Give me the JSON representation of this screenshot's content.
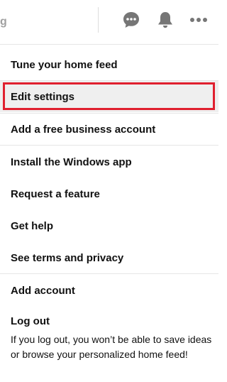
{
  "topbar": {
    "partial_text": "g",
    "icons": [
      "chat-icon",
      "bell-icon",
      "more-icon"
    ]
  },
  "menu": {
    "items": [
      {
        "label": "Tune your home feed"
      },
      {
        "label": "Edit settings"
      },
      {
        "label": "Add a free business account"
      },
      {
        "label": "Install the Windows app"
      },
      {
        "label": "Request a feature"
      },
      {
        "label": "Get help"
      },
      {
        "label": "See terms and privacy"
      },
      {
        "label": "Add account"
      }
    ],
    "logout": {
      "label": "Log out",
      "description": "If you log out, you won’t be able to save ideas or browse your personalized home feed!"
    }
  },
  "colors": {
    "highlight_border": "#e0202f",
    "icon_gray": "#767676"
  }
}
